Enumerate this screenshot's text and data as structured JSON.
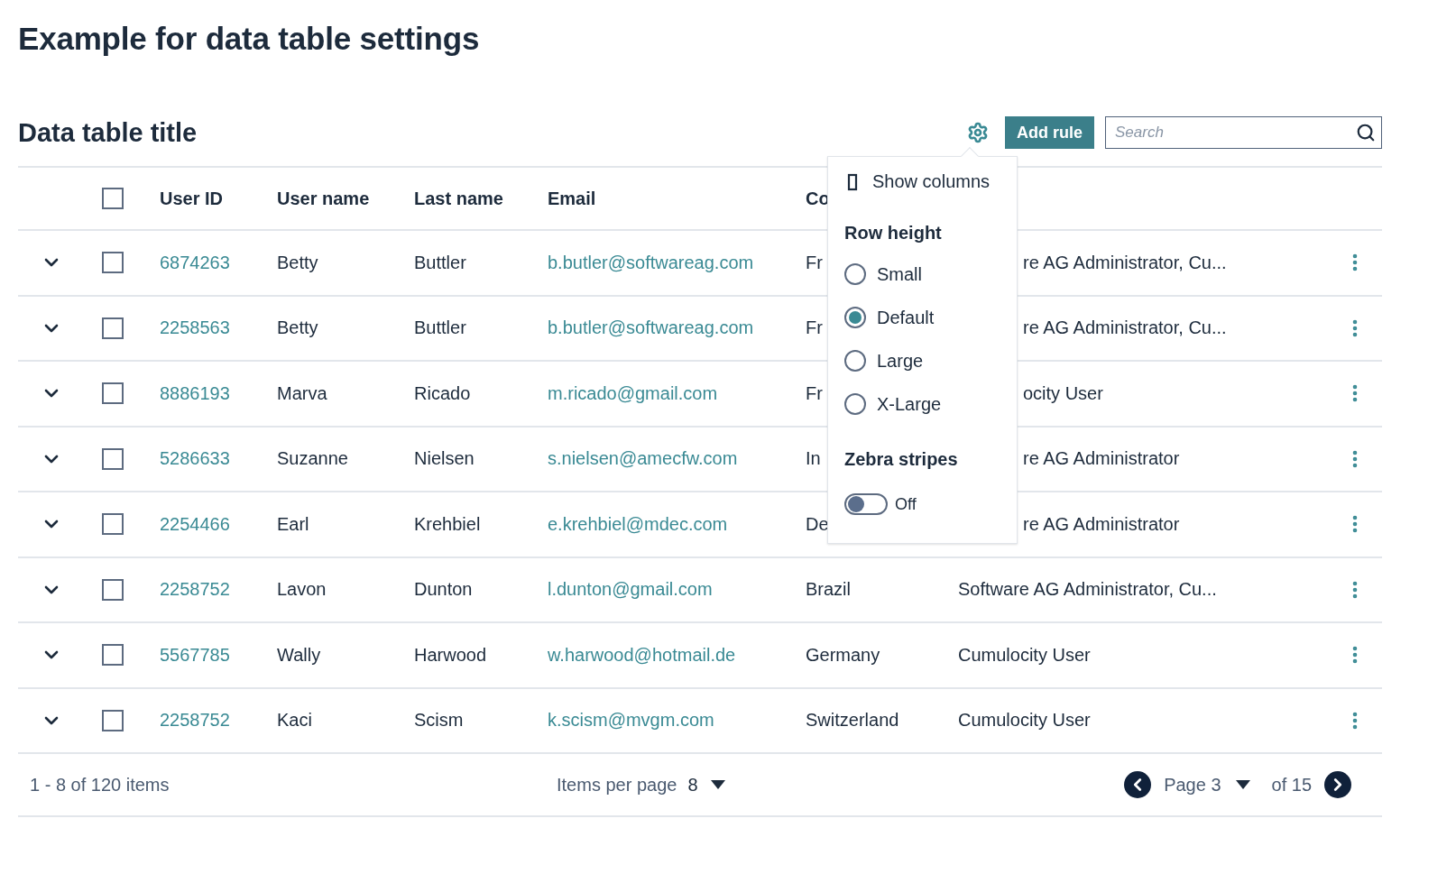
{
  "page_title": "Example for data table settings",
  "table_title": "Data table title",
  "toolbar": {
    "add_button": "Add rule",
    "search": {
      "placeholder": "Search"
    }
  },
  "settings_popup": {
    "show_columns": "Show columns",
    "row_height_label": "Row height",
    "row_heights": [
      {
        "label": "Small",
        "selected": false
      },
      {
        "label": "Default",
        "selected": true
      },
      {
        "label": "Large",
        "selected": false
      },
      {
        "label": "X-Large",
        "selected": false
      }
    ],
    "zebra_label": "Zebra stripes",
    "zebra": {
      "on": false,
      "label": "Off"
    }
  },
  "table": {
    "select_all_checked": false,
    "columns": [
      "User ID",
      "User name",
      "Last name",
      "Email",
      "Co"
    ],
    "rows": [
      {
        "expanded": false,
        "checked": false,
        "user_id": "6874263",
        "user_name": "Betty",
        "last_name": "Buttler",
        "email": "b.butler@softwareag.com",
        "country": "Fr",
        "role": "re AG Administrator, Cu...",
        "partly_hidden": true
      },
      {
        "expanded": false,
        "checked": false,
        "user_id": "2258563",
        "user_name": "Betty",
        "last_name": "Buttler",
        "email": "b.butler@softwareag.com",
        "country": "Fr",
        "role": "re AG Administrator, Cu...",
        "partly_hidden": true
      },
      {
        "expanded": false,
        "checked": false,
        "user_id": "8886193",
        "user_name": "Marva",
        "last_name": "Ricado",
        "email": "m.ricado@gmail.com",
        "country": "Fr",
        "role": "ocity User",
        "partly_hidden": true
      },
      {
        "expanded": false,
        "checked": false,
        "user_id": "5286633",
        "user_name": "Suzanne",
        "last_name": "Nielsen",
        "email": "s.nielsen@amecfw.com",
        "country": "In",
        "role": "re AG Administrator",
        "partly_hidden": true
      },
      {
        "expanded": false,
        "checked": false,
        "user_id": "2254466",
        "user_name": "Earl",
        "last_name": "Krehbiel",
        "email": "e.krehbiel@mdec.com",
        "country": "De",
        "role": "re AG Administrator",
        "partly_hidden": true
      },
      {
        "expanded": false,
        "checked": false,
        "user_id": "2258752",
        "user_name": "Lavon",
        "last_name": "Dunton",
        "email": "l.dunton@gmail.com",
        "country": "Brazil",
        "role": "Software AG Administrator, Cu..."
      },
      {
        "expanded": false,
        "checked": false,
        "user_id": "5567785",
        "user_name": "Wally",
        "last_name": "Harwood",
        "email": "w.harwood@hotmail.de",
        "country": "Germany",
        "role": "Cumulocity User"
      },
      {
        "expanded": false,
        "checked": false,
        "user_id": "2258752",
        "user_name": "Kaci",
        "last_name": "Scism",
        "email": "k.scism@mvgm.com",
        "country": "Switzerland",
        "role": "Cumulocity User"
      }
    ]
  },
  "footer": {
    "range": "1 - 8 of 120 items",
    "items_per_page_label": "Items per page",
    "items_per_page": "8",
    "page": "Page 3",
    "of": "of 15"
  }
}
